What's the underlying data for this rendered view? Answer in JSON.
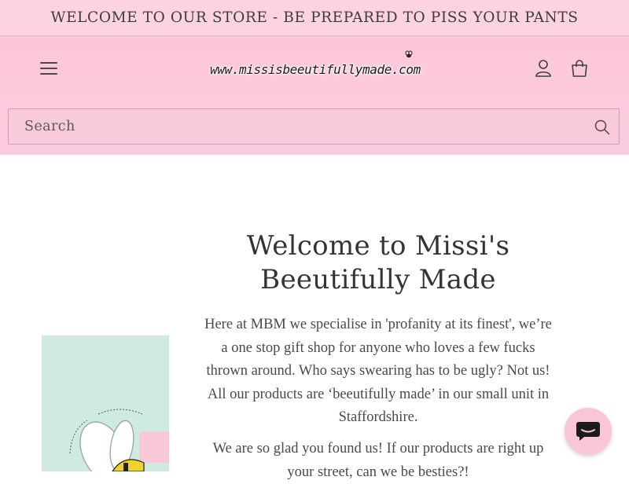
{
  "announcement": {
    "text": "WELCOME TO OUR STORE - BE PREPARED TO PISS YOUR PANTS"
  },
  "header": {
    "logo_text": "www.missisbeeutifullymade.com",
    "icons": {
      "menu": "hamburger-menu-icon",
      "account": "user-icon",
      "cart": "bag-icon",
      "search": "search-icon",
      "chat": "chat-icon"
    }
  },
  "search": {
    "placeholder": "Search"
  },
  "main": {
    "heading": "Welcome to Missi's Beeutifully Made",
    "paragraph_1": "Here at MBM we specialise in 'profanity at its finest', we’re a one stop gift shop for anyone who loves a few fucks thrown around. Who says swearing has to be ugly? Not us! All our products are ‘beeutifully made’ in our small unit in Staffordshire.",
    "paragraph_2": "We are so glad you found us! If our products are right up your street, can we be besties?!"
  },
  "colors": {
    "header_pink": "#fbc8db",
    "announcement_pink": "#fbd3e2",
    "chat_button": "#f9c5d8",
    "product_bg": "#cfeadf"
  }
}
